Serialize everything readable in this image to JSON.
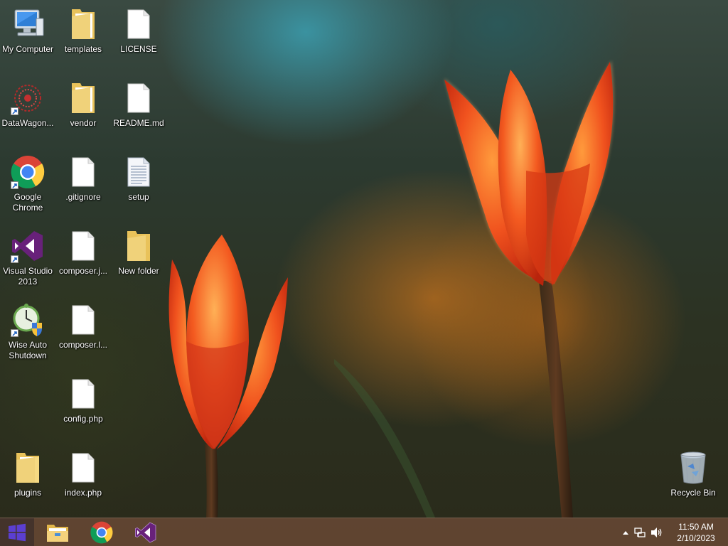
{
  "desktop": {
    "icons": [
      {
        "label": "My Computer"
      },
      {
        "label": "templates"
      },
      {
        "label": "LICENSE"
      },
      {
        "label": "DataWagon..."
      },
      {
        "label": "vendor"
      },
      {
        "label": "README.md"
      },
      {
        "label": "Google Chrome"
      },
      {
        "label": ".gitignore"
      },
      {
        "label": "setup"
      },
      {
        "label": "Visual Studio 2013"
      },
      {
        "label": "composer.j..."
      },
      {
        "label": "New folder"
      },
      {
        "label": "Wise Auto Shutdown"
      },
      {
        "label": "composer.l..."
      },
      {
        "label": "config.php"
      },
      {
        "label": "plugins"
      },
      {
        "label": "index.php"
      },
      {
        "label": "Recycle Bin"
      }
    ]
  },
  "taskbar": {
    "pinned": [
      {
        "icon": "file-explorer-icon"
      },
      {
        "icon": "chrome-icon"
      },
      {
        "icon": "visual-studio-icon"
      }
    ],
    "tray": {
      "time": "11:50 AM",
      "date": "2/10/2023"
    }
  },
  "colors": {
    "taskbar": "#6e4b37",
    "start_logo": "#5b3fd1",
    "visual_studio": "#68217a",
    "folder": "#f0d27a"
  }
}
